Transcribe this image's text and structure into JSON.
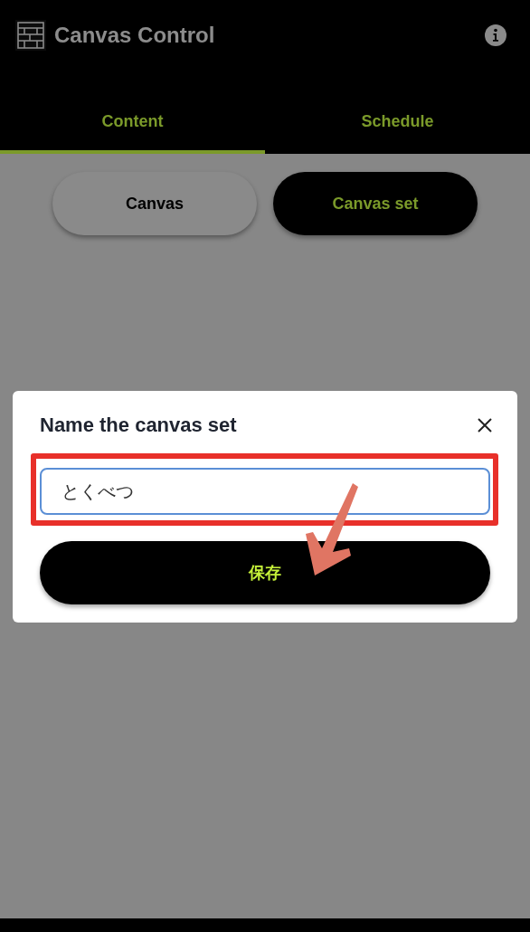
{
  "app_bar": {
    "title": "Canvas Control"
  },
  "tabs": [
    {
      "label": "Content",
      "selected": true
    },
    {
      "label": "Schedule",
      "selected": false
    }
  ],
  "toggles": [
    {
      "label": "Canvas",
      "selected": false
    },
    {
      "label": "Canvas set",
      "selected": true
    }
  ],
  "dialog": {
    "title": "Name the canvas set",
    "field": {
      "value": "とくべつ",
      "focused": true
    },
    "button": "保存"
  }
}
